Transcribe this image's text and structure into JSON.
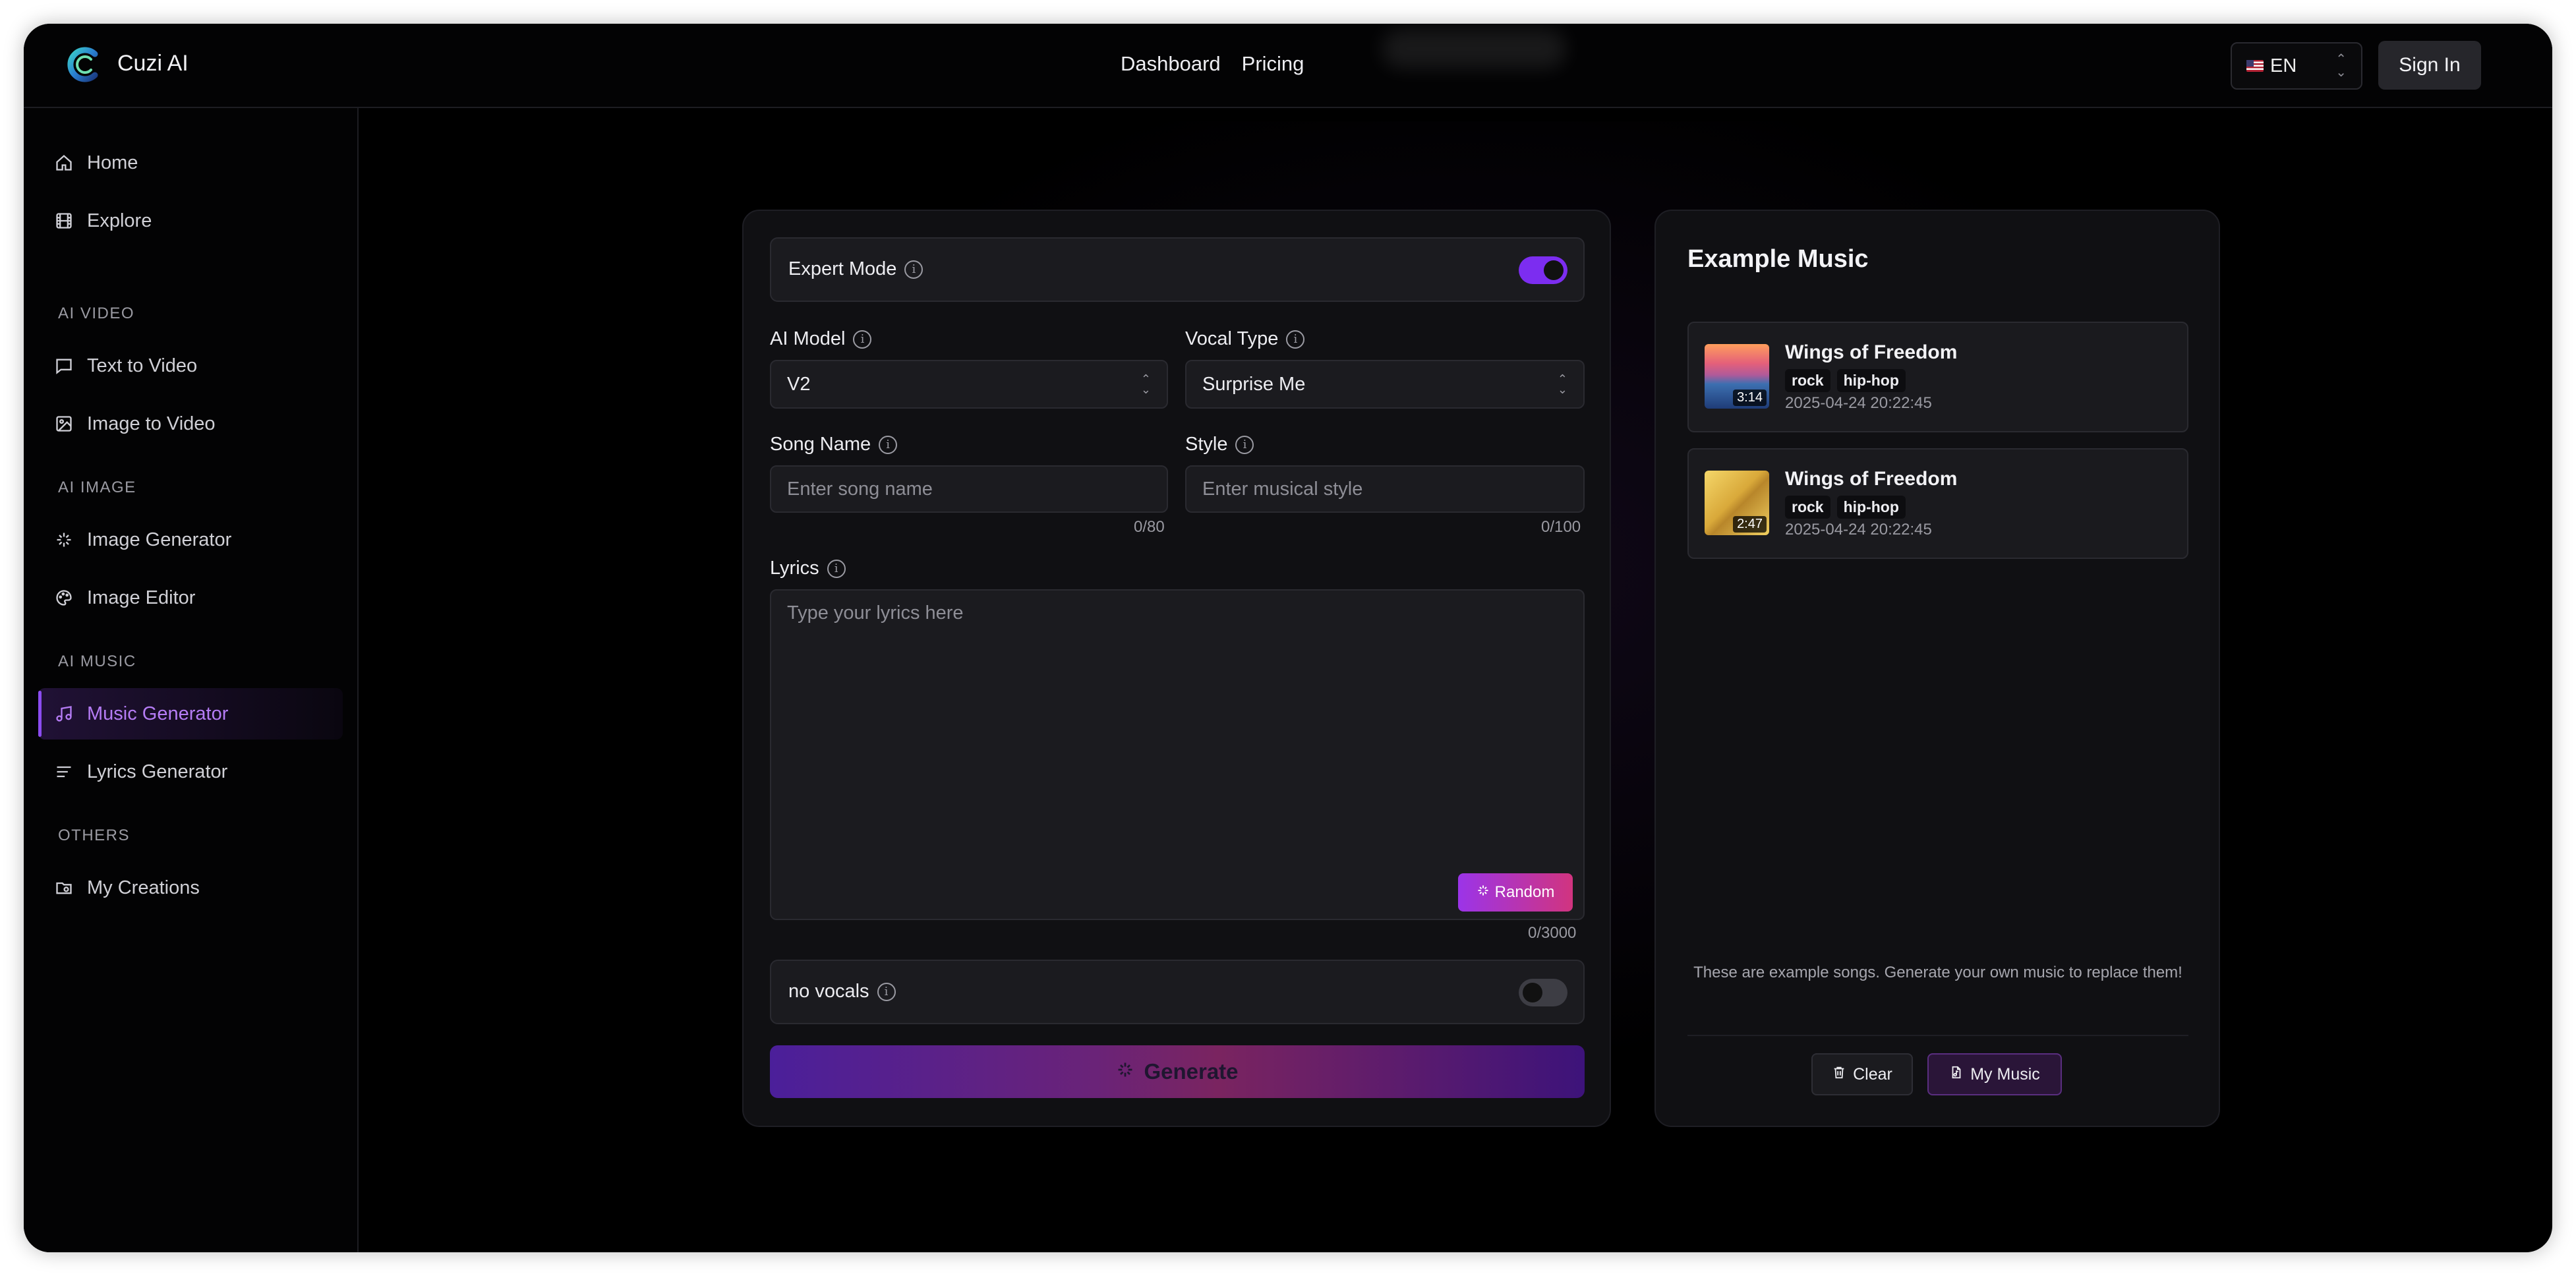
{
  "app": {
    "title": "Cuzi AI"
  },
  "header": {
    "nav": [
      {
        "label": "Dashboard"
      },
      {
        "label": "Pricing"
      }
    ],
    "language": "EN",
    "sign_in": "Sign In"
  },
  "sidebar": {
    "items": [
      {
        "label": "Home",
        "icon": "home-icon"
      },
      {
        "label": "Explore",
        "icon": "film-icon"
      }
    ],
    "sections": [
      {
        "title": "AI VIDEO",
        "items": [
          {
            "label": "Text to Video",
            "icon": "message-icon"
          },
          {
            "label": "Image to Video",
            "icon": "image-icon"
          }
        ]
      },
      {
        "title": "AI IMAGE",
        "items": [
          {
            "label": "Image Generator",
            "icon": "sparkles-icon"
          },
          {
            "label": "Image Editor",
            "icon": "palette-icon"
          }
        ]
      },
      {
        "title": "AI MUSIC",
        "items": [
          {
            "label": "Music Generator",
            "icon": "music-icon",
            "active": true
          },
          {
            "label": "Lyrics Generator",
            "icon": "lines-icon"
          }
        ]
      },
      {
        "title": "OTHERS",
        "items": [
          {
            "label": "My Creations",
            "icon": "folder-icon"
          }
        ]
      }
    ]
  },
  "form": {
    "expert_mode": {
      "label": "Expert Mode",
      "on": true
    },
    "ai_model": {
      "label": "AI Model",
      "value": "V2"
    },
    "vocal_type": {
      "label": "Vocal Type",
      "value": "Surprise Me"
    },
    "song_name": {
      "label": "Song Name",
      "placeholder": "Enter song name",
      "count": "0/80"
    },
    "style": {
      "label": "Style",
      "placeholder": "Enter musical style",
      "count": "0/100"
    },
    "lyrics": {
      "label": "Lyrics",
      "placeholder": "Type your lyrics here",
      "count": "0/3000",
      "random": "Random"
    },
    "no_vocals": {
      "label": "no vocals",
      "on": false
    },
    "generate": "Generate"
  },
  "examples": {
    "title": "Example Music",
    "songs": [
      {
        "title": "Wings of Freedom",
        "tags": [
          "rock",
          "hip-hop"
        ],
        "date": "2025-04-24 20:22:45",
        "duration": "3:14"
      },
      {
        "title": "Wings of Freedom",
        "tags": [
          "rock",
          "hip-hop"
        ],
        "date": "2025-04-24 20:22:45",
        "duration": "2:47"
      }
    ],
    "note": "These are example songs. Generate your own music to replace them!",
    "clear": "Clear",
    "my_music": "My Music"
  },
  "colors": {
    "accent": "#7c2df0",
    "active_text": "#b57cf5",
    "background": "#000000"
  }
}
